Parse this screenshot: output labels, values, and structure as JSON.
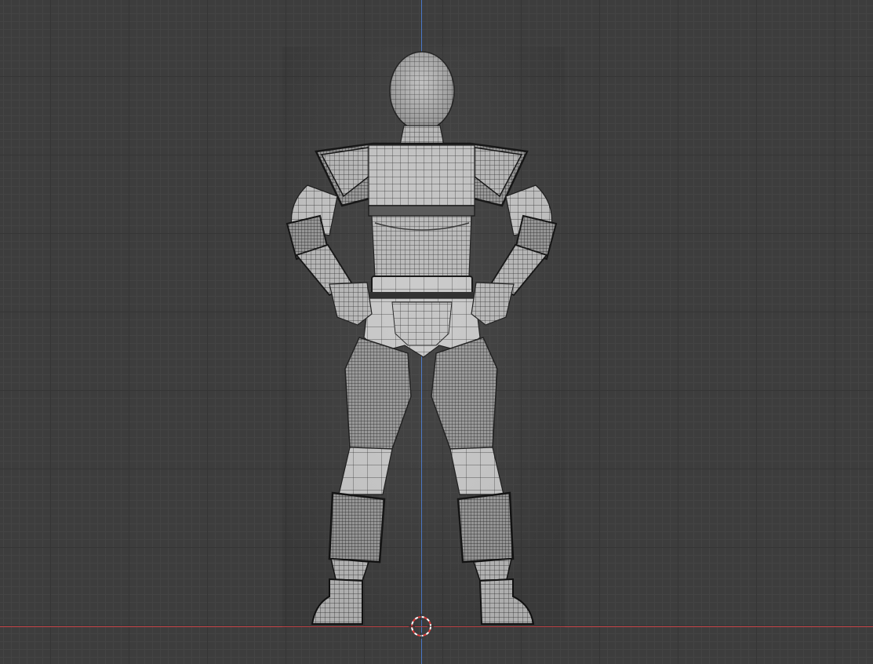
{
  "viewport": {
    "background": "#3d3d3d",
    "grid_minor": "#444444",
    "grid_major": "#353535",
    "axis_z_color": "#4a78c8",
    "axis_x_color": "#c8464a"
  },
  "model": {
    "shading": "wireframe-over-solid",
    "surface_color": "#b8b8b8",
    "wire_color": "#1c1c1c"
  },
  "cursor": {
    "icon": "3d-cursor-icon",
    "ring_red": "#e03c3c",
    "ring_white": "#ffffff"
  }
}
